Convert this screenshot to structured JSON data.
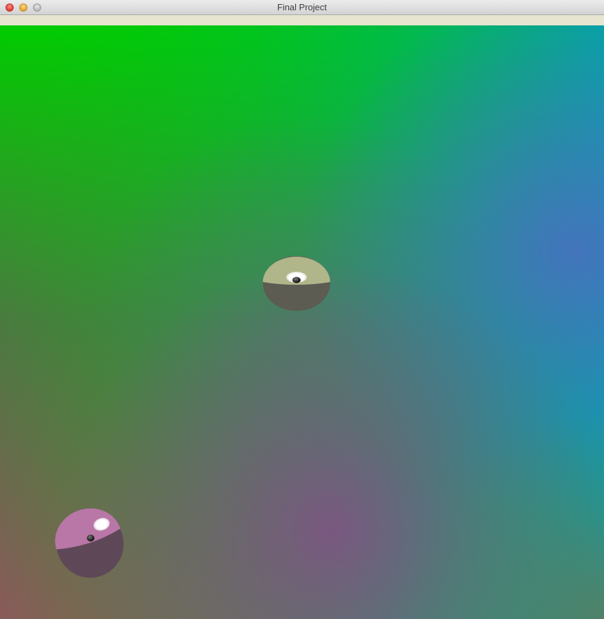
{
  "window": {
    "title": "Final Project"
  },
  "colors": {
    "top_left": "#00cc00",
    "top_right": "#00a5ad",
    "right_mid": "#4a6fb8",
    "center": "#5a7570",
    "bottom_left": "#8a5a5a",
    "bottom_mid": "#884a80",
    "bottom_right": "#5a7a60",
    "strip": "#e7e4cf"
  },
  "scene": {
    "objects": [
      {
        "name": "sphere-olive",
        "top_color": "#b0b68a",
        "bottom_color": "#5c5c52"
      },
      {
        "name": "sphere-pink",
        "top_color": "#b877a6",
        "bottom_color": "#5e4858"
      }
    ]
  }
}
